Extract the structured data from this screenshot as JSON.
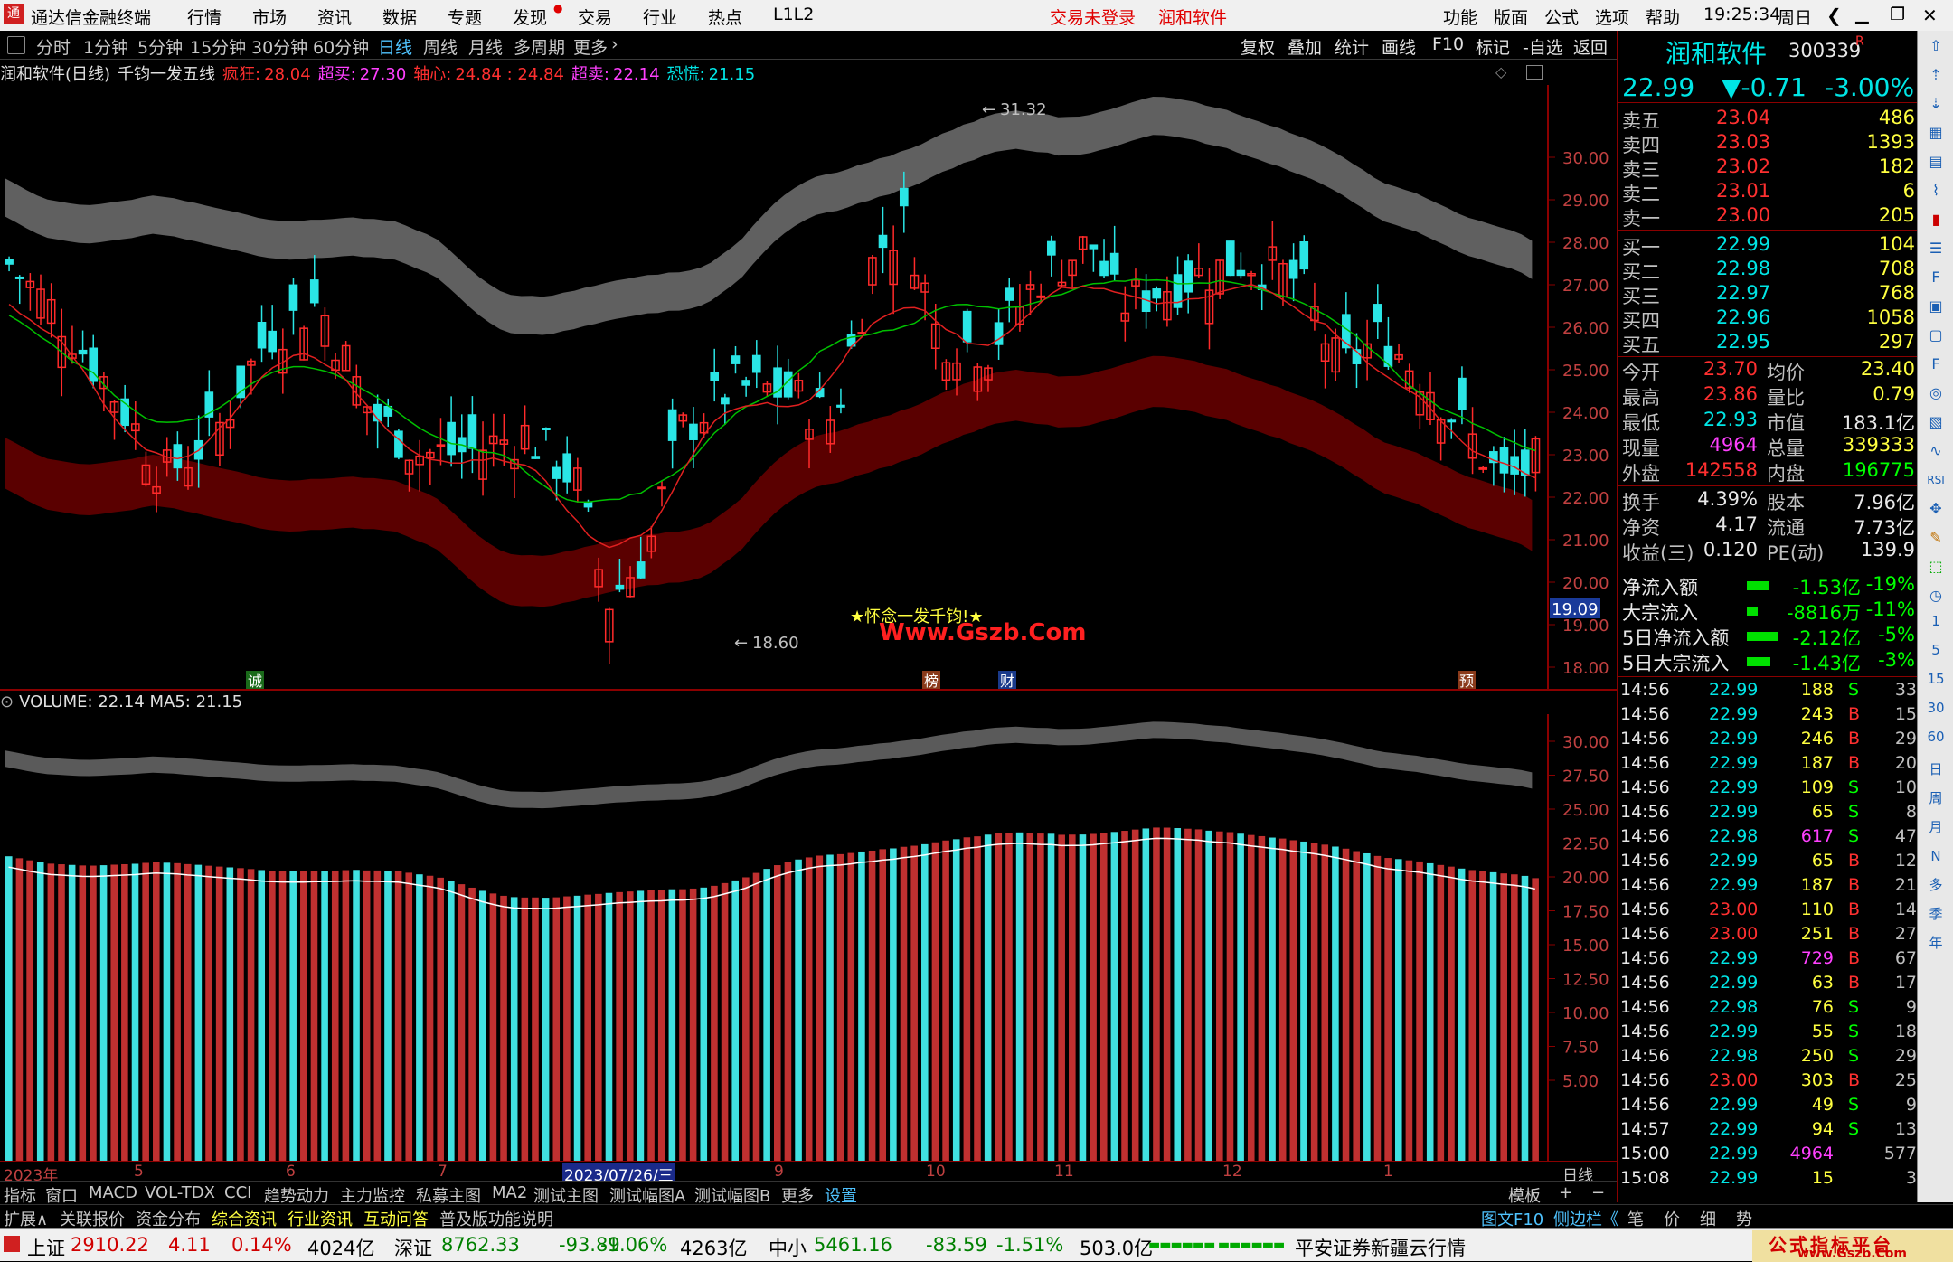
{
  "titlebar": {
    "app_title": "通达信金融终端",
    "menu": [
      "行情",
      "市场",
      "资讯",
      "数据",
      "专题",
      "发现",
      "交易",
      "行业",
      "热点",
      "L1L2"
    ],
    "login_status": "交易未登录",
    "stock_name": "润和软件",
    "right_menu": [
      "功能",
      "版面",
      "公式",
      "选项",
      "帮助"
    ],
    "time": "19:25:34",
    "weekday": "周日"
  },
  "toolbar": {
    "periods": [
      "分时",
      "1分钟",
      "5分钟",
      "15分钟",
      "30分钟",
      "60分钟",
      "日线",
      "周线",
      "月线",
      "多周期",
      "更多"
    ],
    "selected": "日线",
    "right_buttons": [
      "复权",
      "叠加",
      "统计",
      "画线",
      "F10",
      "标记",
      "-自选",
      "返回"
    ]
  },
  "chart_info": {
    "title": "润和软件(日线)",
    "indicator": "千钧一发五线",
    "fengkuang_label": "疯狂:",
    "fengkuang": "28.04",
    "chaomai_label": "超买:",
    "chaomai": "27.30",
    "zhouxin_label": "轴心:",
    "zhouxin": "24.84 : 24.84",
    "chaomai2_label": "超卖:",
    "chaomai2": "22.14",
    "konghuang_label": "恐慌:",
    "konghuang": "21.15"
  },
  "main_chart": {
    "high_mark": "31.32",
    "low_mark": "18.60",
    "current_price_tag": "19.09",
    "annotation": "★怀念一发千钧!★",
    "watermark": "Www.Gszb.Com",
    "event_marks": [
      "诚",
      "榜",
      "财",
      "预"
    ],
    "y_ticks": [
      "30.00",
      "29.00",
      "28.00",
      "27.00",
      "26.00",
      "25.00",
      "24.00",
      "23.00",
      "22.00",
      "21.00",
      "20.00",
      "19.00",
      "18.00"
    ]
  },
  "volume_chart": {
    "info": "VOLUME: 22.14  MA5: 21.15",
    "y_ticks": [
      "30.00",
      "27.50",
      "25.00",
      "22.50",
      "20.00",
      "17.50",
      "15.00",
      "12.50",
      "10.00",
      "7.50",
      "5.00"
    ]
  },
  "xaxis": {
    "labels": [
      "2023年",
      "5",
      "6",
      "7",
      "2023/07/26/三",
      "9",
      "10",
      "11",
      "12",
      "1"
    ],
    "period_label": "日线"
  },
  "tabs_row1": [
    "指标",
    "窗口",
    "MACD",
    "VOL-TDX",
    "CCI",
    "趋势动力",
    "主力监控",
    "私募主图",
    "MA2",
    "测试主图",
    "测试幅图A",
    "测试幅图B",
    "更多",
    "设置"
  ],
  "tabs_row1_right": [
    "模板",
    "+",
    "−"
  ],
  "tabs_row2": [
    "扩展∧",
    "关联报价",
    "资金分布",
    "综合资讯",
    "行业资讯",
    "互动问答",
    "普及版功能说明"
  ],
  "tabs_row2_right": [
    "图文F10",
    "侧边栏《",
    "笔",
    "价",
    "细",
    "势"
  ],
  "quote": {
    "name": "润和软件",
    "code": "300339",
    "flag": "R",
    "price": "22.99",
    "change": "▼-0.71",
    "change_pct": "-3.00%",
    "asks": [
      {
        "label": "卖五",
        "price": "23.04",
        "vol": "486"
      },
      {
        "label": "卖四",
        "price": "23.03",
        "vol": "1393"
      },
      {
        "label": "卖三",
        "price": "23.02",
        "vol": "182"
      },
      {
        "label": "卖二",
        "price": "23.01",
        "vol": "6"
      },
      {
        "label": "卖一",
        "price": "23.00",
        "vol": "205"
      }
    ],
    "bids": [
      {
        "label": "买一",
        "price": "22.99",
        "vol": "104"
      },
      {
        "label": "买二",
        "price": "22.98",
        "vol": "708"
      },
      {
        "label": "买三",
        "price": "22.97",
        "vol": "768"
      },
      {
        "label": "买四",
        "price": "22.96",
        "vol": "1058"
      },
      {
        "label": "买五",
        "price": "22.95",
        "vol": "297"
      }
    ],
    "stats": [
      {
        "l1": "今开",
        "v1": "23.70",
        "l2": "均价",
        "v2": "23.40",
        "c1": "c-red",
        "c2": "c-yellow"
      },
      {
        "l1": "最高",
        "v1": "23.86",
        "l2": "量比",
        "v2": "0.79",
        "c1": "c-red",
        "c2": "c-yellow"
      },
      {
        "l1": "最低",
        "v1": "22.93",
        "l2": "市值",
        "v2": "183.1亿",
        "c1": "c-cyan",
        "c2": "c-white"
      },
      {
        "l1": "现量",
        "v1": "4964",
        "l2": "总量",
        "v2": "339333",
        "c1": "c-mag",
        "c2": "c-yellow"
      },
      {
        "l1": "外盘",
        "v1": "142558",
        "l2": "内盘",
        "v2": "196775",
        "c1": "c-red",
        "c2": "c-green"
      },
      {
        "l1": "换手",
        "v1": "4.39%",
        "l2": "股本",
        "v2": "7.96亿",
        "c1": "c-white",
        "c2": "c-white"
      },
      {
        "l1": "净资",
        "v1": "4.17",
        "l2": "流通",
        "v2": "7.73亿",
        "c1": "c-white",
        "c2": "c-white"
      },
      {
        "l1": "收益(三)",
        "v1": "0.120",
        "l2": "PE(动)",
        "v2": "139.9",
        "c1": "c-white",
        "c2": "c-white"
      }
    ],
    "flows": [
      {
        "label": "净流入额",
        "val": "-1.53亿",
        "pct": "-19%"
      },
      {
        "label": "大宗流入",
        "val": "-8816万",
        "pct": "-11%"
      },
      {
        "label": "5日净流入额",
        "val": "-2.12亿",
        "pct": "-5%"
      },
      {
        "label": "5日大宗流入",
        "val": "-1.43亿",
        "pct": "-3%"
      }
    ],
    "ticks": [
      {
        "t": "14:56",
        "p": "22.99",
        "v": "188",
        "bs": "S",
        "n": "33"
      },
      {
        "t": "14:56",
        "p": "22.99",
        "v": "243",
        "bs": "B",
        "n": "15"
      },
      {
        "t": "14:56",
        "p": "22.99",
        "v": "246",
        "bs": "B",
        "n": "29"
      },
      {
        "t": "14:56",
        "p": "22.99",
        "v": "187",
        "bs": "B",
        "n": "20"
      },
      {
        "t": "14:56",
        "p": "22.99",
        "v": "109",
        "bs": "S",
        "n": "10"
      },
      {
        "t": "14:56",
        "p": "22.99",
        "v": "65",
        "bs": "S",
        "n": "8"
      },
      {
        "t": "14:56",
        "p": "22.98",
        "v": "617",
        "bs": "S",
        "n": "47"
      },
      {
        "t": "14:56",
        "p": "22.99",
        "v": "65",
        "bs": "B",
        "n": "12"
      },
      {
        "t": "14:56",
        "p": "22.99",
        "v": "187",
        "bs": "B",
        "n": "21"
      },
      {
        "t": "14:56",
        "p": "23.00",
        "v": "110",
        "bs": "B",
        "n": "14"
      },
      {
        "t": "14:56",
        "p": "23.00",
        "v": "251",
        "bs": "B",
        "n": "27"
      },
      {
        "t": "14:56",
        "p": "22.99",
        "v": "729",
        "bs": "B",
        "n": "67"
      },
      {
        "t": "14:56",
        "p": "22.99",
        "v": "63",
        "bs": "B",
        "n": "17"
      },
      {
        "t": "14:56",
        "p": "22.98",
        "v": "76",
        "bs": "S",
        "n": "9"
      },
      {
        "t": "14:56",
        "p": "22.99",
        "v": "55",
        "bs": "S",
        "n": "18"
      },
      {
        "t": "14:56",
        "p": "22.98",
        "v": "250",
        "bs": "S",
        "n": "29"
      },
      {
        "t": "14:56",
        "p": "23.00",
        "v": "303",
        "bs": "B",
        "n": "25"
      },
      {
        "t": "14:56",
        "p": "22.99",
        "v": "49",
        "bs": "S",
        "n": "9"
      },
      {
        "t": "14:57",
        "p": "22.99",
        "v": "94",
        "bs": "S",
        "n": "13"
      },
      {
        "t": "15:00",
        "p": "22.99",
        "v": "4964",
        "bs": "",
        "n": "577"
      },
      {
        "t": "15:08",
        "p": "22.99",
        "v": "15",
        "bs": "",
        "n": "3"
      }
    ]
  },
  "sidebar_letters": [
    "1",
    "5",
    "15",
    "30",
    "60",
    "日",
    "周",
    "月",
    "N",
    "多",
    "季",
    "年"
  ],
  "statusbar": {
    "indices": [
      {
        "name": "上证",
        "value": "2910.22",
        "chg": "4.11",
        "pct": "0.14%",
        "amt": "4024亿",
        "dir": "up"
      },
      {
        "name": "深证",
        "value": "8762.33",
        "chg": "-93.89",
        "pct": "-1.06%",
        "amt": "4263亿",
        "dir": "down"
      },
      {
        "name": "中小",
        "value": "5461.16",
        "chg": "-83.59",
        "pct": "-1.51%",
        "amt": "503.0亿",
        "dir": "down"
      }
    ],
    "broker": "平安证券新疆云行情",
    "brand": "公式指标平台",
    "brand_url": "www.Gszb.Com"
  },
  "colors": {
    "up": "#ff3030",
    "down": "#00e5e5",
    "ma": "#00c000",
    "accent": "#4fc3ff"
  }
}
